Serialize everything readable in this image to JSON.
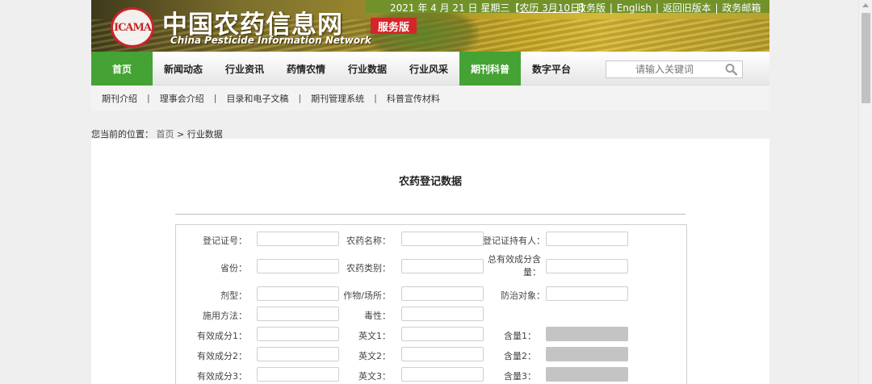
{
  "header": {
    "date": "2021 年 4 月 21 日 星期三【",
    "lunar": "农历 3月10日",
    "date_end": "】",
    "links": [
      "政务版",
      "English",
      "返回旧版本",
      "政务邮箱"
    ],
    "logo_text": "ICAMA",
    "title": "中国农药信息网",
    "subtitle": "China Pesticide Information Network",
    "badge": "服务版"
  },
  "nav": {
    "items": [
      "首页",
      "新闻动态",
      "行业资讯",
      "药情农情",
      "行业数据",
      "行业风采",
      "期刊科普",
      "数字平台"
    ],
    "search_placeholder": "请输入关键词"
  },
  "subnav": {
    "items": [
      "期刊介绍",
      "理事会介绍",
      "目录和电子文稿",
      "期刊管理系统",
      "科普宣传材料"
    ]
  },
  "breadcrumb": {
    "prefix": "您当前的位置：",
    "home": "首页",
    "arrow": ">",
    "current": "行业数据"
  },
  "page": {
    "title": "农药登记数据"
  },
  "form": {
    "fields": [
      {
        "label": "登记证号：",
        "value": ""
      },
      {
        "label": "农药名称：",
        "value": ""
      },
      {
        "label": "登记证持有人：",
        "value": ""
      },
      {
        "label": "省份：",
        "value": ""
      },
      {
        "label": "农药类别：",
        "value": ""
      },
      {
        "label": "总有效成分含量：",
        "value": ""
      },
      {
        "label": "剂型：",
        "value": ""
      },
      {
        "label": "作物/场所：",
        "value": ""
      },
      {
        "label": "防治对象：",
        "value": ""
      },
      {
        "label": "施用方法：",
        "value": ""
      },
      {
        "label": "毒性：",
        "value": ""
      },
      {
        "label": "有效成分1：",
        "value": ""
      },
      {
        "label": "英文1：",
        "value": ""
      },
      {
        "label": "含量1：",
        "value": ""
      },
      {
        "label": "有效成分2：",
        "value": ""
      },
      {
        "label": "英文2：",
        "value": ""
      },
      {
        "label": "含量2：",
        "value": ""
      },
      {
        "label": "有效成分3：",
        "value": ""
      },
      {
        "label": "英文3：",
        "value": ""
      },
      {
        "label": "含量3：",
        "value": ""
      }
    ]
  },
  "colors": {
    "nav_active": "#45a234",
    "topbar": "#71922a",
    "badge": "#d4262a",
    "disabled_input": "#c4c4c4"
  }
}
